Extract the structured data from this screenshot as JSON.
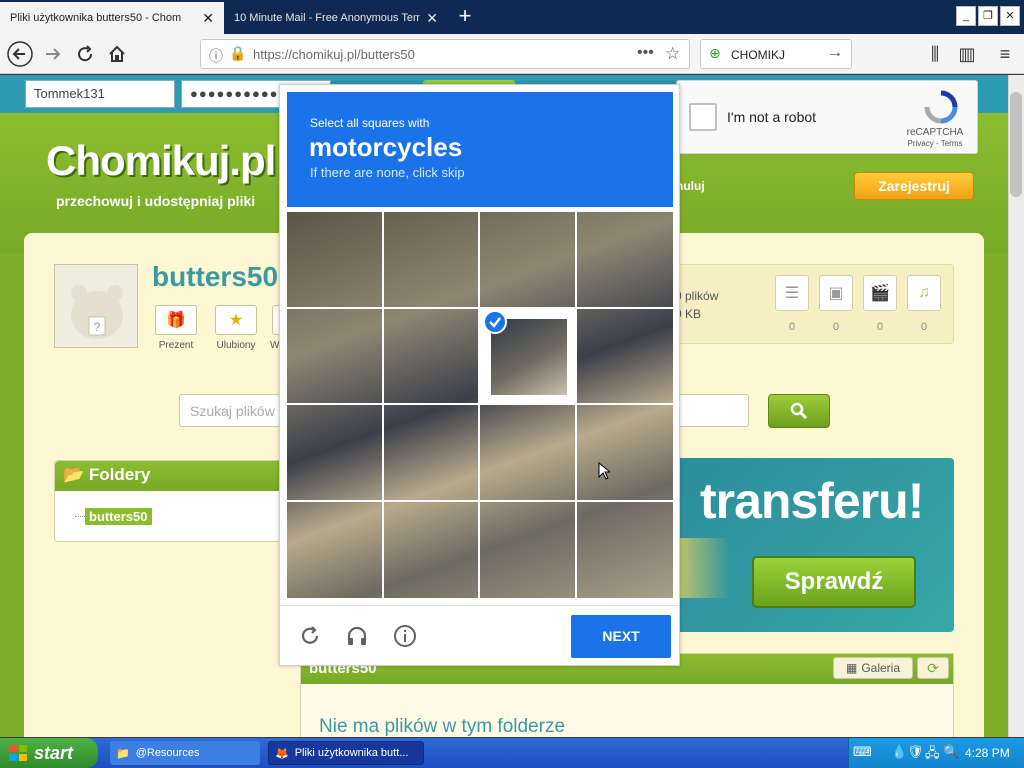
{
  "browser": {
    "tabs": [
      {
        "title": "Pliki użytkownika butters50 - Chom",
        "active": true
      },
      {
        "title": "10 Minute Mail - Free Anonymous Temp",
        "active": false
      }
    ],
    "url": "https://chomikuj.pl/butters50",
    "search_engine_text": "CHOMIKJ"
  },
  "site": {
    "login_value": "Tommek131",
    "password_value": "●●●●●●●●●●●●",
    "logo": "Chomikuj.pl",
    "tagline": "przechowuj i udostępniaj pliki",
    "register": "Zarejestruj",
    "anuluj": "nuluj",
    "username": "butters50",
    "actions": [
      {
        "label": "Prezent",
        "icon": "gift-icon"
      },
      {
        "label": "Ulubiony",
        "icon": "star-icon"
      },
      {
        "label": "W",
        "icon": "more-icon"
      }
    ],
    "stats": {
      "files": "0 plików",
      "size": "0 KB"
    },
    "file_type_counts": [
      "0",
      "0",
      "0",
      "0"
    ],
    "search_placeholder": "Szukaj plików",
    "folders_title": "Foldery",
    "folder_item": "butters50",
    "banner_text": "transferu!",
    "banner_button": "Sprawdź",
    "file_panel_title": "butters50",
    "galeria": "Galeria",
    "no_files": "Nie ma plików w tym folderze"
  },
  "recaptcha": {
    "checkbox_label": "I'm not a robot",
    "brand": "reCAPTCHA",
    "links": "Privacy - Terms"
  },
  "challenge": {
    "line1": "Select all squares with",
    "line2": "motorcycles",
    "line3": "If there are none, click skip",
    "next_label": "NEXT",
    "selected_tiles": [
      6
    ],
    "colors": {
      "primary": "#1a73e8"
    }
  },
  "taskbar": {
    "start": "start",
    "items": [
      "@Resources",
      "Pliki użytkownika butt..."
    ],
    "time": "4:28 PM"
  }
}
